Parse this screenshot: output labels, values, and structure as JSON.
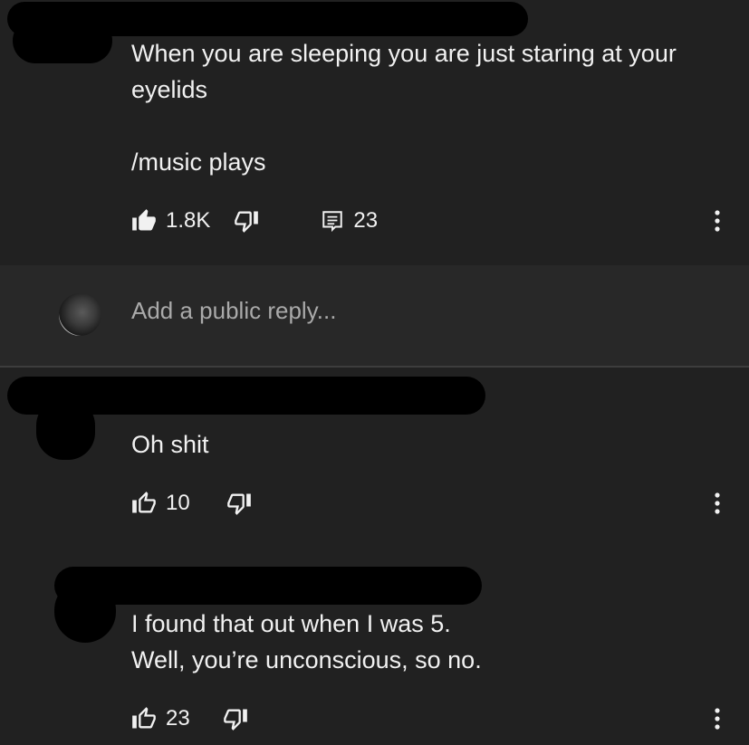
{
  "top_comment": {
    "text": "When you are sleeping you are just staring at your\neyelids\n\n/music plays",
    "likes": "1.8K",
    "replies": "23"
  },
  "reply_box": {
    "placeholder": "Add a public reply..."
  },
  "replies": [
    {
      "text": "Oh shit",
      "likes": "10"
    },
    {
      "text": "I found that out when I was 5.\nWell, you’re unconscious, so no.",
      "likes": "23"
    }
  ],
  "icons": {
    "like_filled": "thumbs-up-filled-icon",
    "like": "thumbs-up-icon",
    "dislike": "thumbs-down-icon",
    "replies": "comment-icon",
    "more": "more-vertical-icon"
  },
  "colors": {
    "background": "#212121",
    "reply_background": "#282828",
    "text": "#f1f1f1",
    "placeholder": "#aaaaaa"
  }
}
